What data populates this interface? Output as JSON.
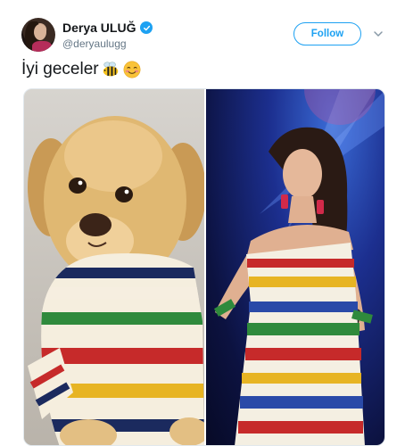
{
  "author": {
    "display_name": "Derya ULUĞ",
    "handle": "@deryaulugg",
    "verified": true
  },
  "follow_button": {
    "label": "Follow"
  },
  "tweet": {
    "text": "İyi geceler",
    "emojis": [
      "bee-emoji",
      "smiling-blush-emoji"
    ]
  },
  "media": {
    "images": [
      {
        "subject": "puppy-in-striped-sweater"
      },
      {
        "subject": "singer-in-striped-dress"
      }
    ]
  },
  "colors": {
    "accent": "#1da1f2",
    "text_primary": "#14171a",
    "text_secondary": "#657786"
  }
}
